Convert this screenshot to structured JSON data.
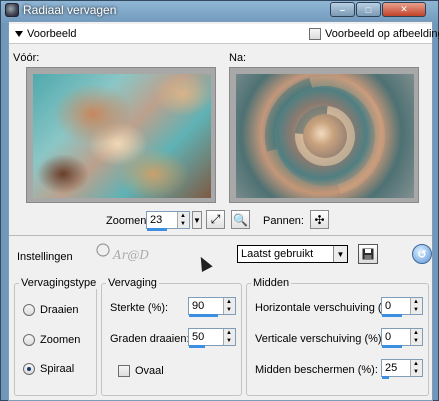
{
  "window": {
    "title": "Radiaal vervagen",
    "min_glyph": "–",
    "max_glyph": "□",
    "close_glyph": "✕"
  },
  "preview": {
    "section_label": "Voorbeeld",
    "show_on_image_label": "Voorbeeld op afbeelding",
    "show_on_image_checked": false,
    "before_label": "Vóór:",
    "after_label": "Na:"
  },
  "zoom": {
    "label": "Zoomen:",
    "value": "23",
    "fit_icon": "fit-window-icon",
    "navigate_icon": "zoom-lens-icon",
    "pan_label": "Pannen:",
    "pan_icon": "move-icon"
  },
  "settings": {
    "label": "Instellingen",
    "logo_text": "Ar@D",
    "preset_value": "Laatst gebruikt",
    "save_icon": "save-disk-icon",
    "reset_icon": "reset-icon"
  },
  "blur_type": {
    "title": "Vervagingstype",
    "options": [
      "Draaien",
      "Zoomen",
      "Spiraal"
    ],
    "selected": "Spiraal"
  },
  "blur": {
    "title": "Vervaging",
    "strength_label": "Sterkte (%):",
    "strength_value": "90",
    "strength_fraction": 0.9,
    "twist_label": "Graden draaien:",
    "twist_value": "50",
    "twist_fraction": 0.5,
    "oval_label": "Ovaal",
    "oval_checked": false
  },
  "center": {
    "title": "Midden",
    "h_offset_label": "Horizontale verschuiving (%):",
    "h_offset_value": "0",
    "v_offset_label": "Verticale verschuiving (%):",
    "v_offset_value": "0",
    "protect_label": "Midden beschermen (%):",
    "protect_value": "25",
    "protect_fraction": 0.25
  },
  "colors": {
    "title_bar": "#7b9fc0",
    "accent_bar": "#3b8ee0",
    "close_button": "#c1422a"
  }
}
